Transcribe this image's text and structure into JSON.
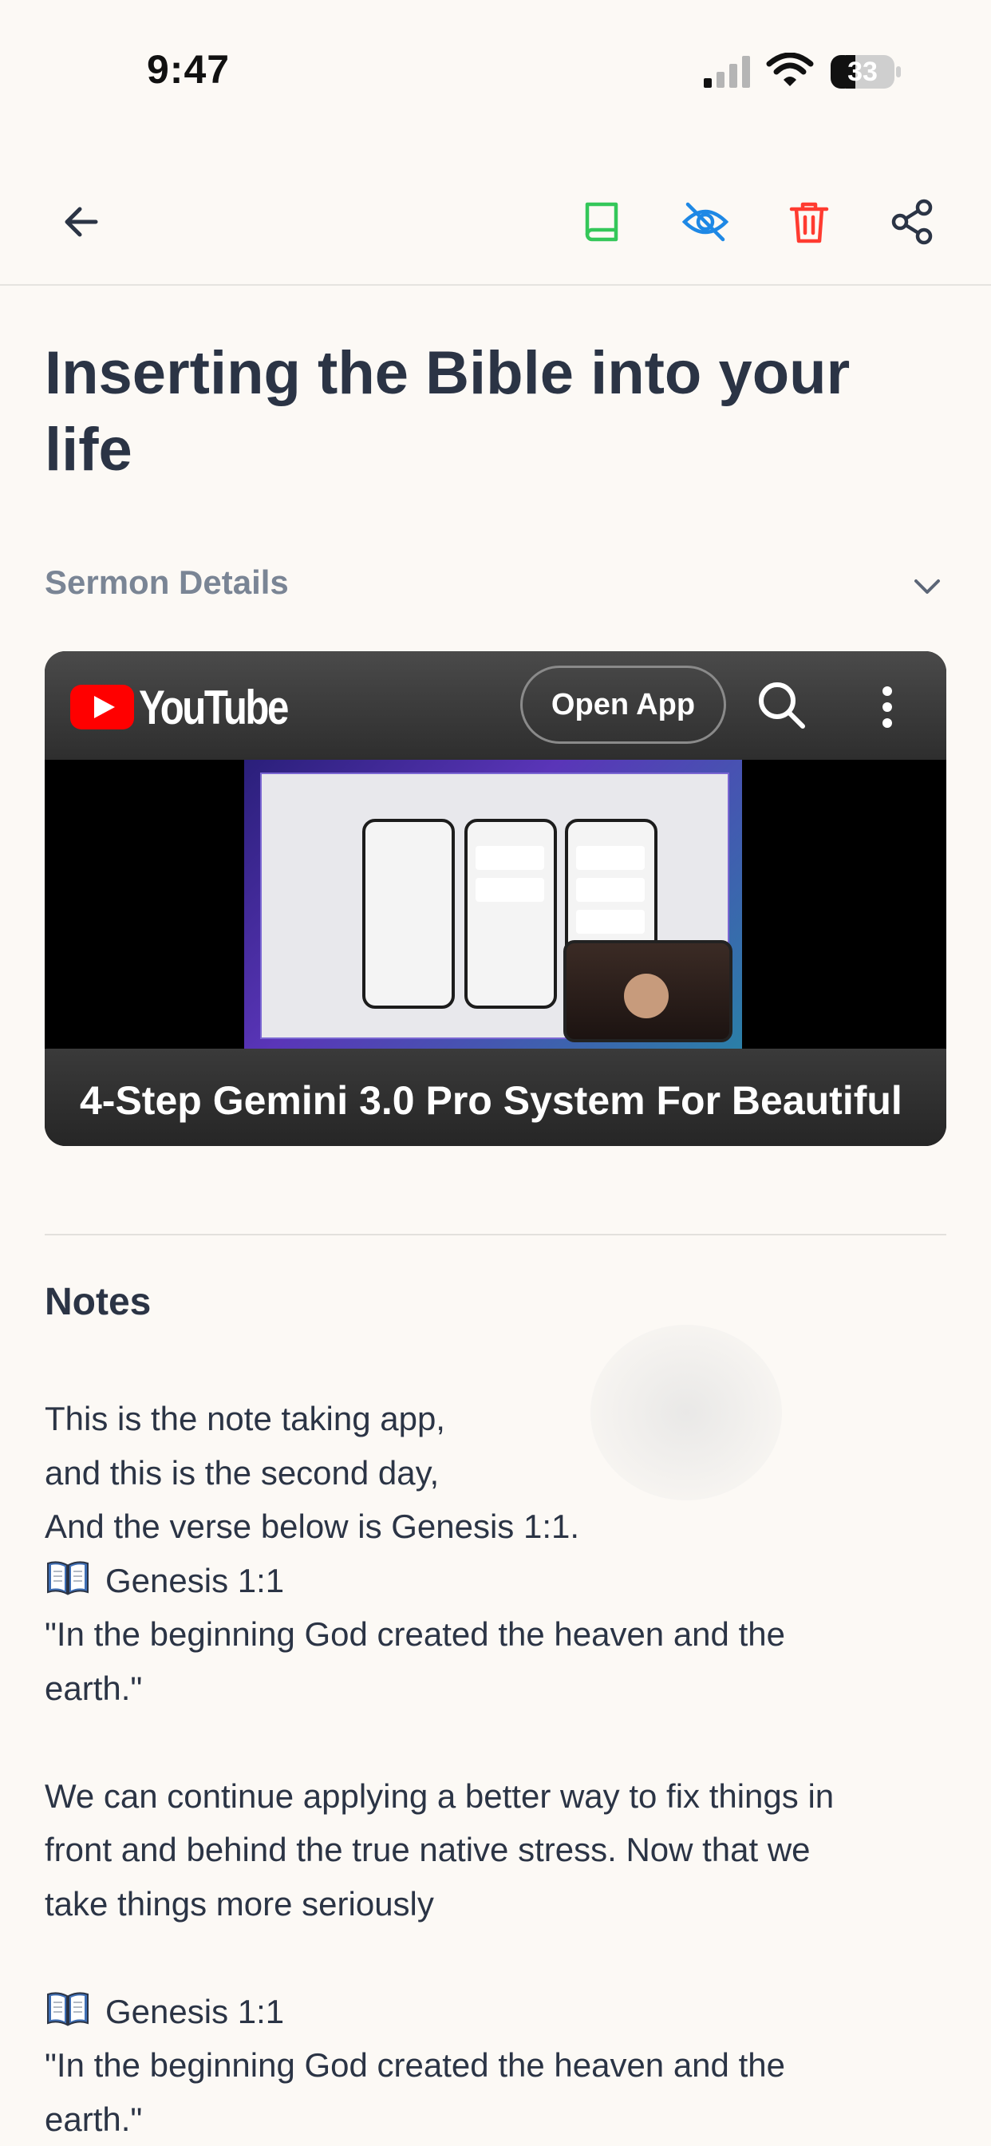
{
  "status_bar": {
    "time": "9:47",
    "battery": "33",
    "icons": [
      "signal-icon",
      "wifi-icon",
      "battery-icon"
    ]
  },
  "toolbar": {
    "icons": [
      "back-arrow-icon",
      "book-icon",
      "eye-off-icon",
      "trash-icon",
      "share-icon"
    ],
    "colors": {
      "book": "#34C759",
      "visibility": "#1E88E5",
      "delete": "#FF3B30",
      "default": "#2B3445"
    }
  },
  "sermon": {
    "title": "Inserting the Bible into your life",
    "details_label": "Sermon Details"
  },
  "video": {
    "brand": "YouTube",
    "open_app_label": "Open App",
    "title": "4-Step Gemini 3.0 Pro System For Beautiful"
  },
  "notes": {
    "heading": "Notes",
    "lines": [
      "This is the note taking app,",
      "and this is the second day,",
      "And the verse below is Genesis 1:1.",
      "Genesis 1:1",
      "\"In the beginning God created the heaven and the",
      "earth.\"",
      "We can continue applying a better way to fix things in",
      "front and behind the true native stress.  Now that we",
      "take things more seriously",
      "Genesis 1:1",
      "\"In the beginning God created the heaven and the",
      "earth.\""
    ]
  }
}
